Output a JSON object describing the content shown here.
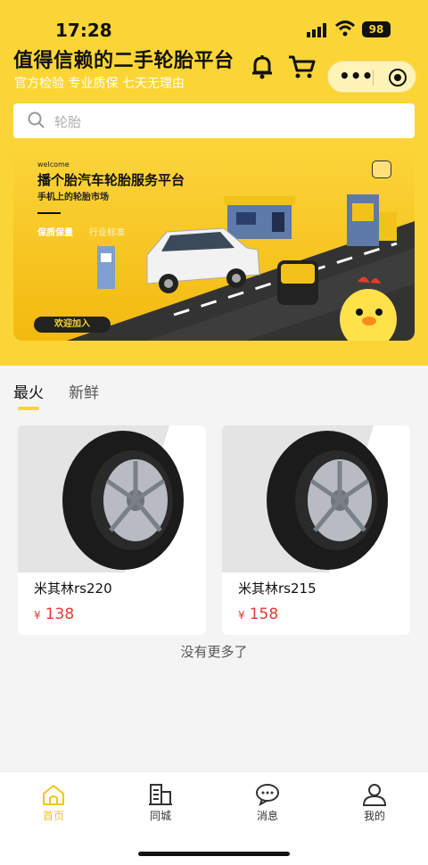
{
  "status_bar": {
    "time": "17:28",
    "battery": "98"
  },
  "header": {
    "title": "值得信赖的二手轮胎平台",
    "subtitle": "官方检验 专业质保 七天无理由"
  },
  "search": {
    "placeholder": "轮胎"
  },
  "banner": {
    "welcome": "welcome",
    "title": "播个胎汽车轮胎服务平台",
    "subtitle": "手机上的轮胎市场",
    "tag1": "保质保量",
    "tag2": "行业标准",
    "button": "欢迎加入"
  },
  "tabs": [
    {
      "label": "最火",
      "active": true
    },
    {
      "label": "新鲜",
      "active": false
    }
  ],
  "products": [
    {
      "name": "米其林rs220",
      "currency": "¥",
      "price": "138"
    },
    {
      "name": "米其林rs215",
      "currency": "¥",
      "price": "158"
    }
  ],
  "no_more": "没有更多了",
  "tabbar": [
    {
      "label": "首页",
      "icon": "home-icon",
      "active": true
    },
    {
      "label": "同城",
      "icon": "buildings-icon",
      "active": false
    },
    {
      "label": "消息",
      "icon": "chat-bubble-icon",
      "active": false
    },
    {
      "label": "我的",
      "icon": "person-icon",
      "active": false
    }
  ],
  "colors": {
    "accent": "#fbd535",
    "price": "#e53935",
    "active_tab": "#f5c518"
  }
}
